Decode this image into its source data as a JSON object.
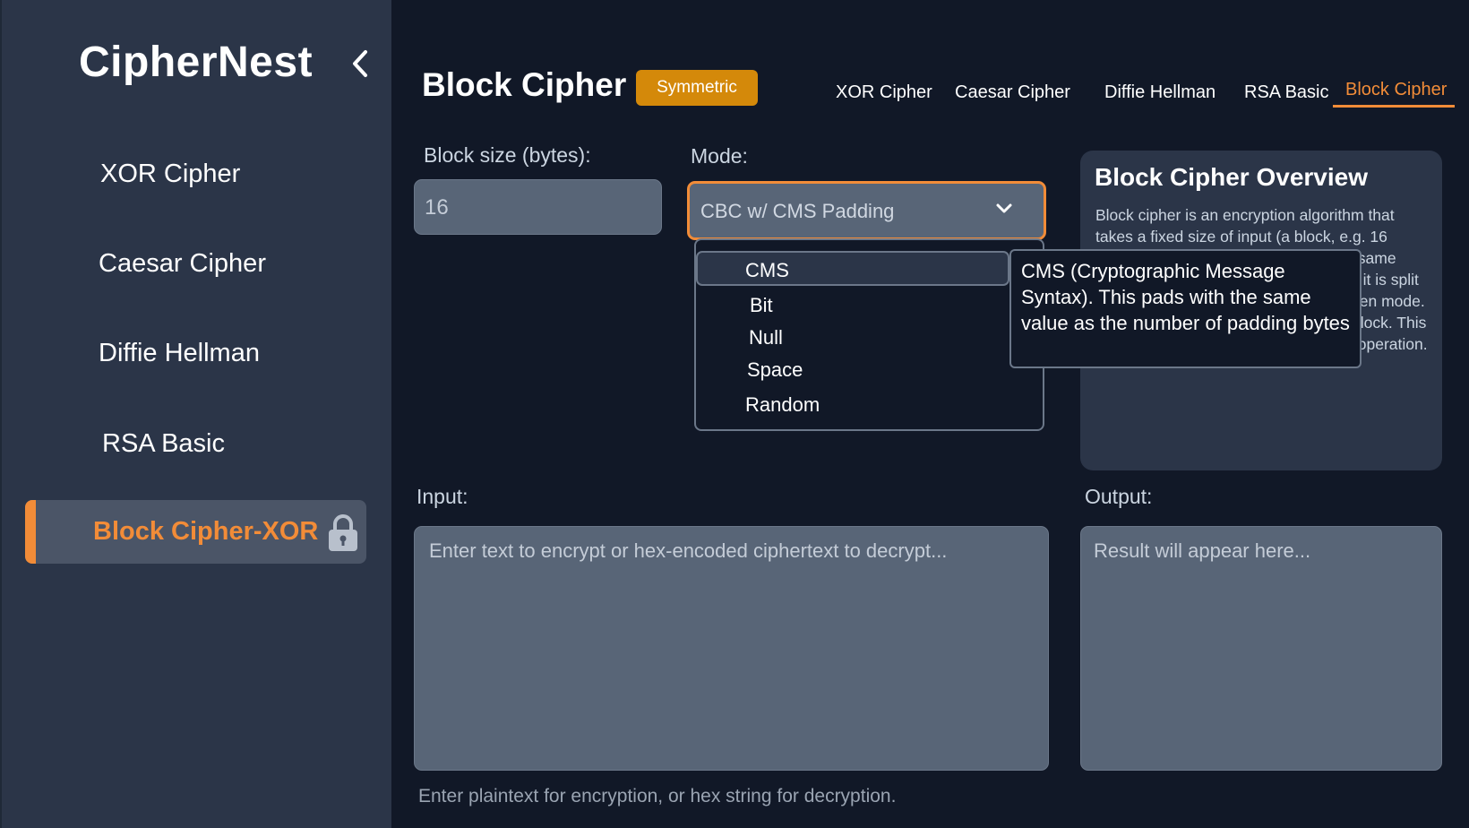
{
  "sidebar": {
    "brand": "CipherNest",
    "items": [
      {
        "label": "XOR Cipher"
      },
      {
        "label": "Caesar Cipher"
      },
      {
        "label": "Diffie Hellman"
      },
      {
        "label": "RSA Basic"
      }
    ],
    "active_item": "Block Cipher-XOR"
  },
  "header": {
    "title": "Block Cipher",
    "badge": "Symmetric",
    "tabs": [
      {
        "label": "XOR Cipher"
      },
      {
        "label": "Caesar Cipher"
      },
      {
        "label": "Diffie Hellman"
      },
      {
        "label": "RSA Basic"
      },
      {
        "label": "Block Cipher",
        "active": true
      }
    ]
  },
  "form": {
    "block_size_label": "Block size (bytes):",
    "block_size_value": "16",
    "mode_label": "Mode:",
    "mode_value": "CBC w/ CMS Padding",
    "padding_options": [
      "CMS",
      "Bit",
      "Null",
      "Space",
      "Random"
    ],
    "highlighted_option": "CMS",
    "tooltip": "CMS (Cryptographic Message Syntax). This pads with the same value as the number of padding bytes",
    "input_label": "Input:",
    "input_placeholder": "Enter text to encrypt or hex-encoded ciphertext to decrypt...",
    "output_label": "Output:",
    "output_placeholder": "Result will appear here...",
    "hint": "Enter plaintext for encryption, or hex string for decryption."
  },
  "overview": {
    "title": "Block Cipher Overview",
    "text": "Block cipher is an encryption algorithm that takes a fixed size of input (a block, e.g. 16 bytes) and produces ciphertext of the same size. If the input is larger than a block, it is split into blocks and processed with a chosen mode. Padding is often required for the last block. This example uses XOR as the core block operation."
  },
  "colors": {
    "accent": "#f28c38",
    "badge": "#d4890a",
    "background": "#111827",
    "sidebar": "#2b3548",
    "field": "#586577"
  },
  "icons": {
    "collapse": "chevron-left-icon",
    "lock": "lock-icon",
    "dropdown": "chevron-down-icon"
  }
}
